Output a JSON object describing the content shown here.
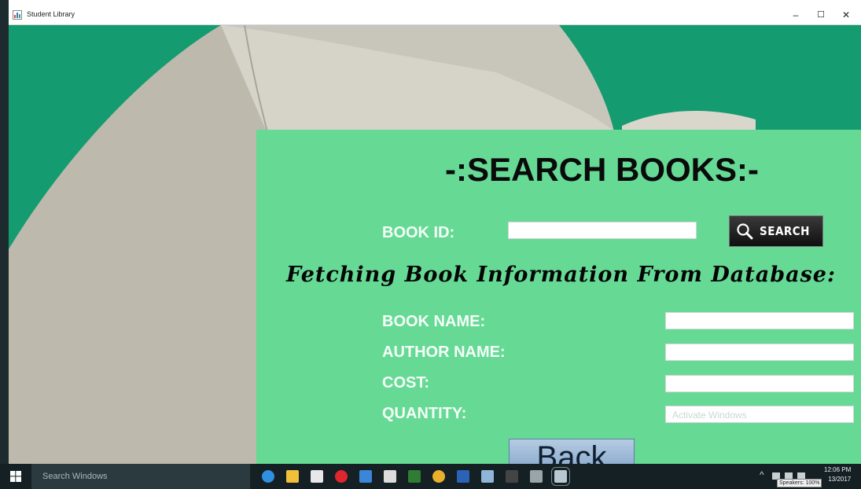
{
  "window": {
    "title": "Student Library",
    "controls": {
      "minimize": "–",
      "maximize": "☐",
      "close": "✕"
    }
  },
  "form": {
    "heading": "-:SEARCH BOOKS:-",
    "book_id_label": "BOOK ID:",
    "book_id_value": "",
    "search_button": "SEARCH",
    "fetching_text": "Fetching Book Information From Database:",
    "fields": {
      "book_name": {
        "label": "BOOK NAME:",
        "value": ""
      },
      "author_name": {
        "label": "AUTHOR NAME:",
        "value": ""
      },
      "cost": {
        "label": "COST:",
        "value": ""
      },
      "quantity": {
        "label": "QUANTITY:",
        "value": ""
      }
    },
    "back_button": "Back",
    "watermark": "Activate Windows"
  },
  "taskbar": {
    "search_placeholder": "Search Windows",
    "apps": [
      {
        "name": "edge-icon",
        "color": "#2f8fe0"
      },
      {
        "name": "file-explorer-icon",
        "color": "#f0c03a"
      },
      {
        "name": "store-icon",
        "color": "#e8e8e8"
      },
      {
        "name": "opera-icon",
        "color": "#e0262d"
      },
      {
        "name": "app-icon",
        "color": "#3b86d8"
      },
      {
        "name": "camera-icon",
        "color": "#dcdcdc"
      },
      {
        "name": "paint-icon",
        "color": "#2e7d32"
      },
      {
        "name": "chrome-icon",
        "color": "#e8b02c"
      },
      {
        "name": "word-icon",
        "color": "#2b63b5"
      },
      {
        "name": "notepad-icon",
        "color": "#8fb5d8"
      },
      {
        "name": "cmd-icon",
        "color": "#444444"
      },
      {
        "name": "tool-icon",
        "color": "#9aa5a8"
      },
      {
        "name": "java-app-icon",
        "color": "#b9c7d2"
      }
    ],
    "tooltip": "Speakers: 100%",
    "time": "12:06 PM",
    "date_partial": "13/2017"
  }
}
